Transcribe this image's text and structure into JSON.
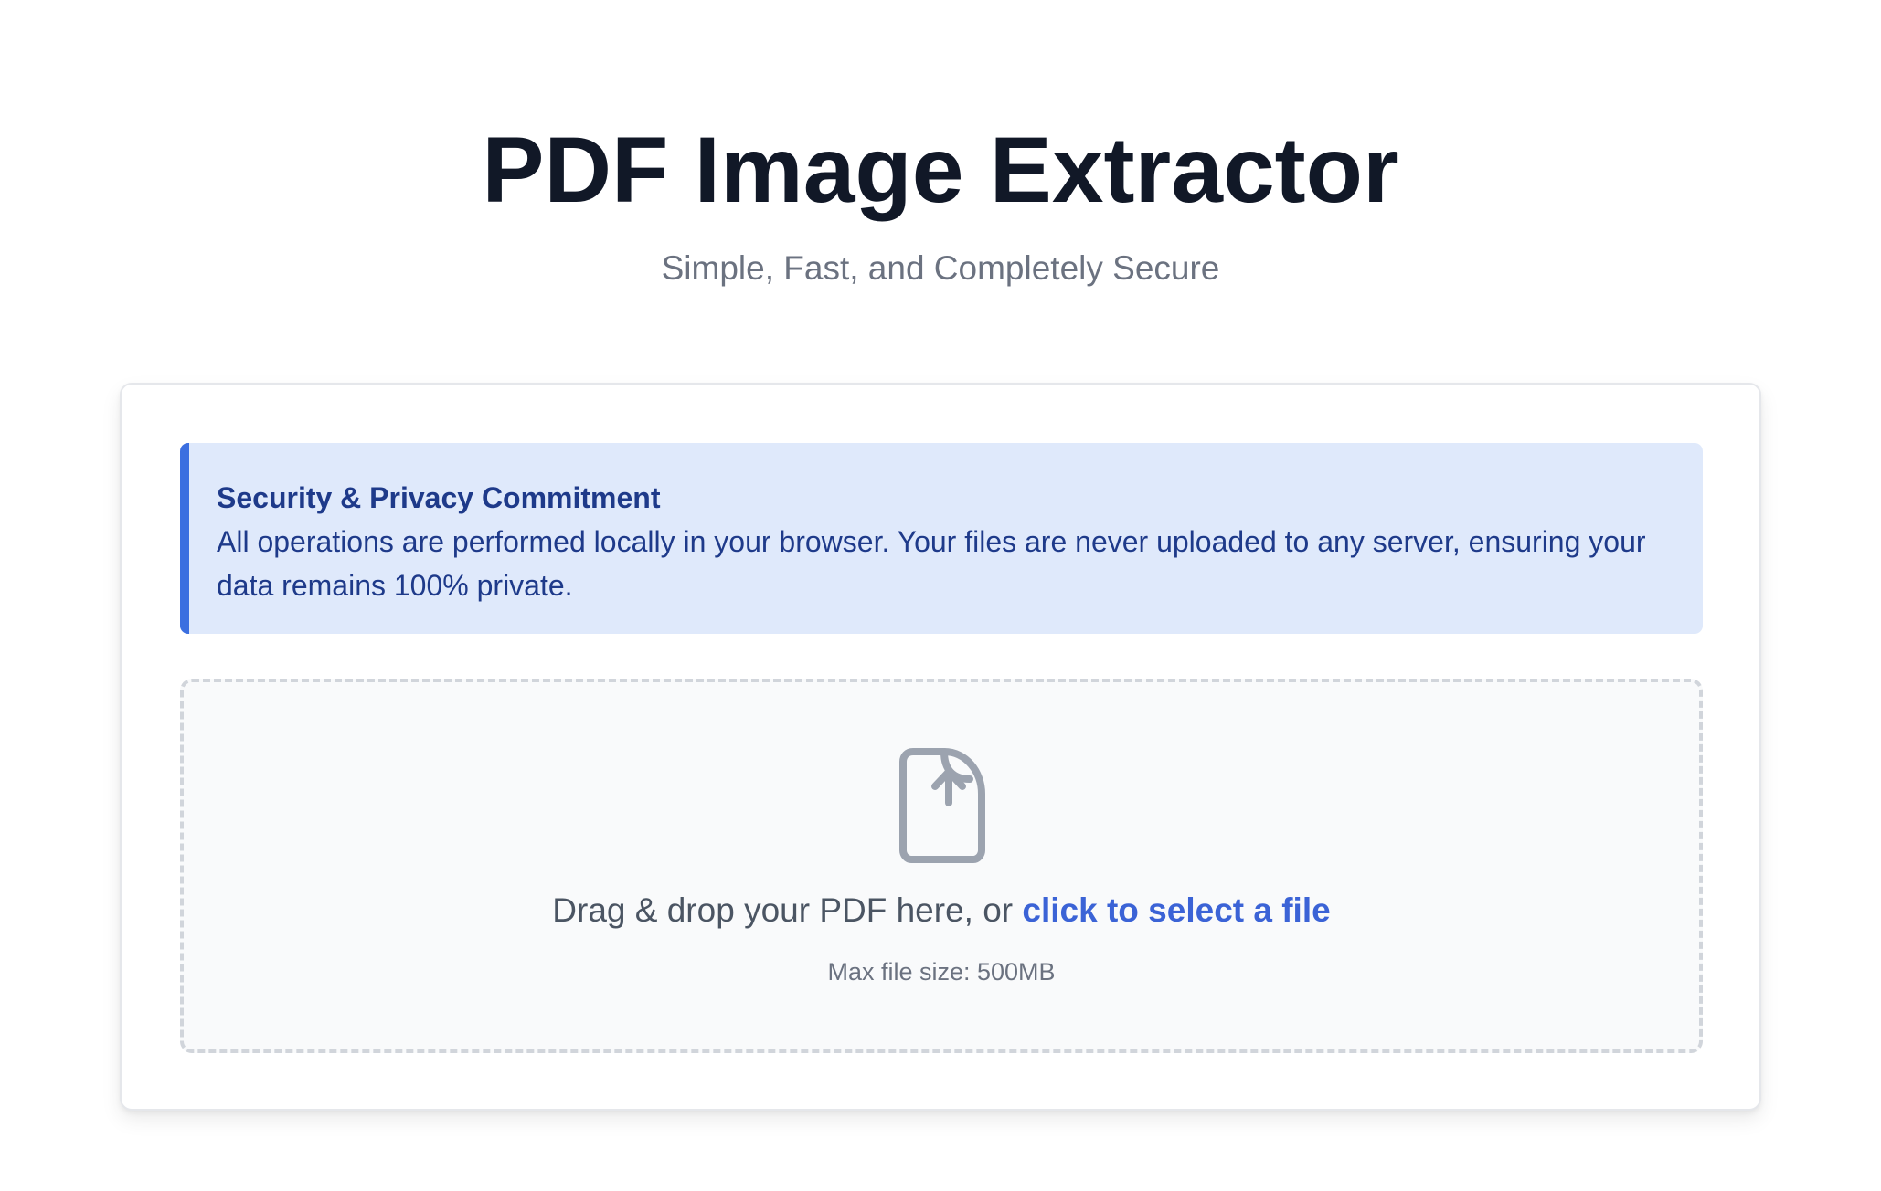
{
  "header": {
    "title": "PDF Image Extractor",
    "subtitle": "Simple, Fast, and Completely Secure"
  },
  "notice": {
    "title": "Security & Privacy Commitment",
    "text": "All operations are performed locally in your browser. Your files are never uploaded to any server, ensuring your data remains 100% private."
  },
  "dropzone": {
    "icon": "file-upload-icon",
    "text_prefix": "Drag & drop your PDF here, or ",
    "link_text": "click to select a file",
    "max_size": "Max file size: 500MB"
  },
  "colors": {
    "title": "#111827",
    "subtitle": "#6b7280",
    "notice_background": "#dfe9fb",
    "notice_accent": "#3b6fe0",
    "notice_text": "#1e3a8a",
    "link": "#3b63d6",
    "icon": "#9ca3af"
  }
}
